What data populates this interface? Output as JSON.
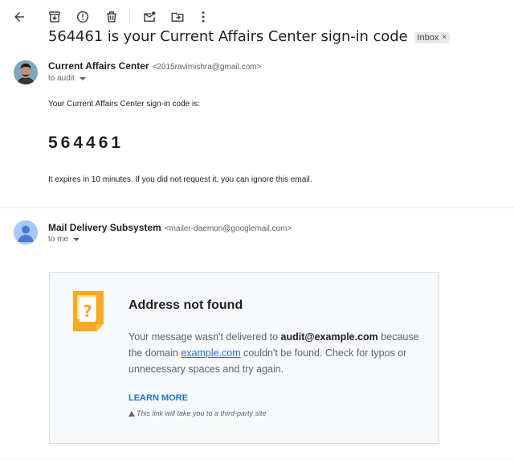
{
  "toolbar": {
    "icons": [
      "back-arrow-icon",
      "archive-icon",
      "report-spam-icon",
      "delete-icon",
      "mark-unread-icon",
      "move-to-icon",
      "more-icon"
    ]
  },
  "email": {
    "subject": "564461 is your Current Affairs Center sign-in code",
    "label_chip": "Inbox",
    "chip_close": "×"
  },
  "message1": {
    "sender_name": "Current Affairs Center",
    "sender_email": "<2015ravimishra@gmail.com>",
    "recipient": "to audit",
    "intro": "Your Current Affairs Center sign-in code is:",
    "code": "564461",
    "footer": "It expires in 10 minutes. If you did not request it, you can ignore this email."
  },
  "message2": {
    "sender_name": "Mail Delivery Subsystem",
    "sender_email": "<mailer-daemon@googlemail.com>",
    "recipient": "to me",
    "card": {
      "title": "Address not found",
      "msg_part1": "Your message wasn't delivered to ",
      "msg_address": "audit@example.com",
      "msg_part2": " because the domain ",
      "msg_domain": "example.com",
      "msg_part3": " couldn't be found. Check for typos or unnecessary spaces and try again.",
      "learn_more": "LEARN MORE",
      "third_party": "This link will take you to a third-party site"
    }
  },
  "colors": {
    "link": "#1a73e8",
    "ndr_icon": "#f9a825",
    "avatar_default": "#a0c3ff"
  }
}
